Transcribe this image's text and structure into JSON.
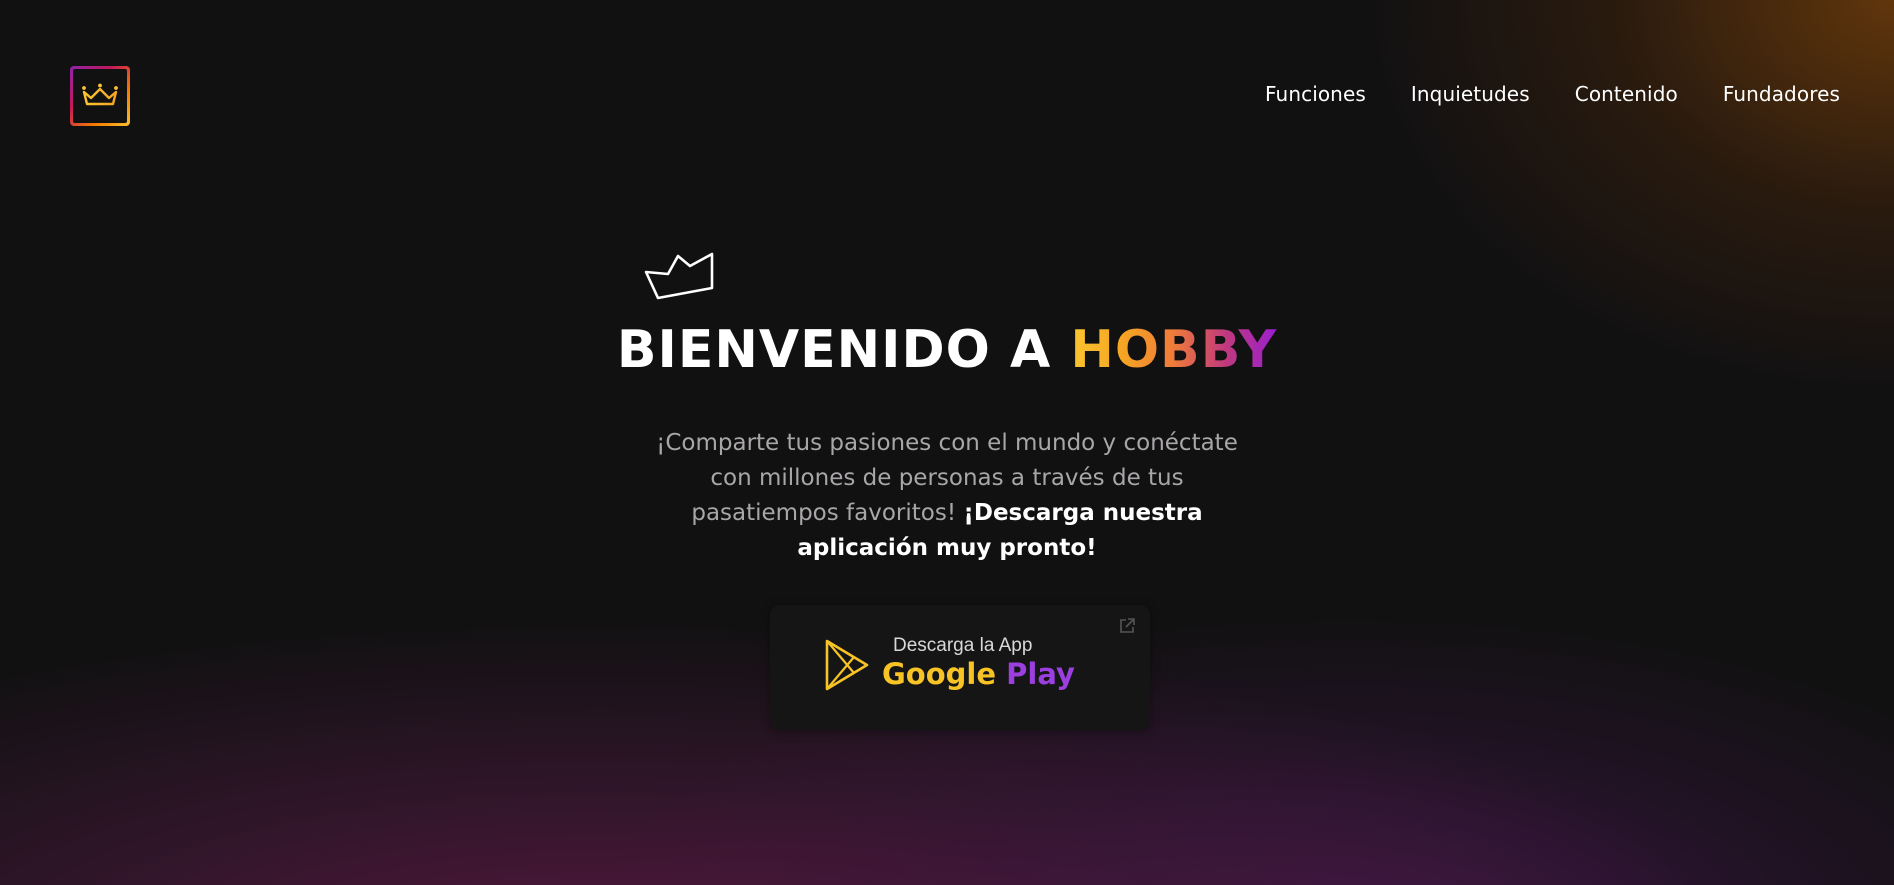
{
  "header": {
    "logo_icon": "crown-icon",
    "nav": [
      {
        "label": "Funciones"
      },
      {
        "label": "Inquietudes"
      },
      {
        "label": "Contenido"
      },
      {
        "label": "Fundadores"
      }
    ]
  },
  "hero": {
    "decoration_icon": "crown-outline-icon",
    "title_prefix": "BIENVENIDO A ",
    "title_brand": "HOBBY",
    "description": "¡Comparte tus pasiones con el mundo y conéctate con millones de personas a través de tus pasatiempos favoritos! ",
    "description_strong": "¡Descarga nuestra aplicación muy pronto!"
  },
  "download": {
    "small_label": "Descarga la App",
    "store_word1": "Google",
    "store_word2": "Play",
    "icon": "google-play-icon",
    "external_icon": "external-link-icon"
  },
  "colors": {
    "background": "#121112",
    "brand_yellow": "#f7c325",
    "brand_purple": "#9b3fe0",
    "brand_pink": "#c0397d",
    "brand_orange": "#ef7b3a"
  }
}
